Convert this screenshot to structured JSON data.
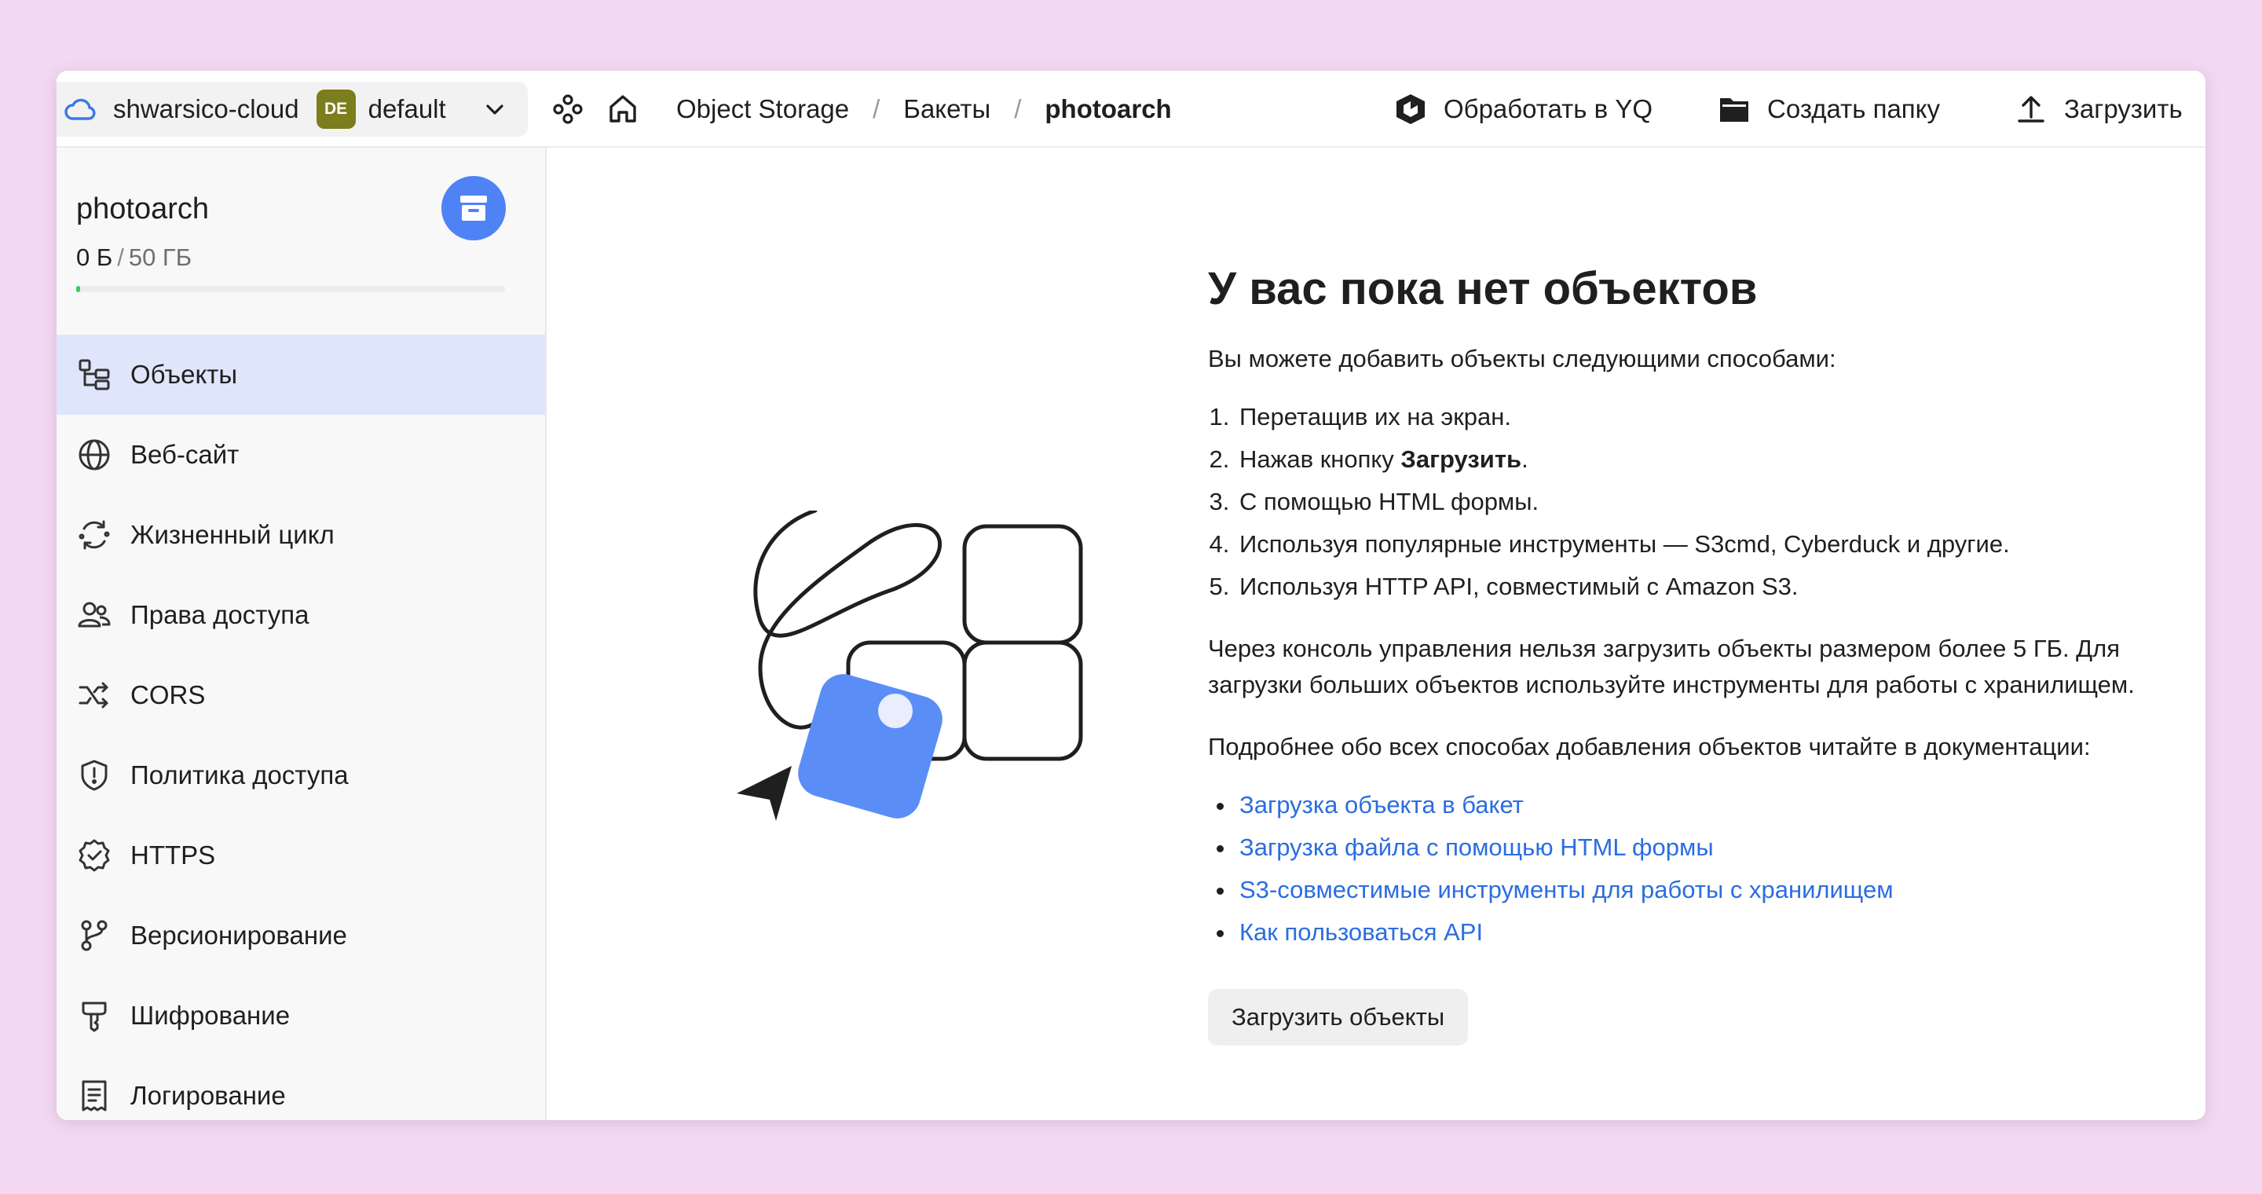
{
  "topbar": {
    "cloud_name": "shwarsico-cloud",
    "folder_badge": "DE",
    "folder_name": "default",
    "breadcrumb": {
      "service": "Object Storage",
      "section": "Бакеты",
      "current": "photoarch"
    },
    "actions": {
      "process_yq": "Обработать в YQ",
      "create_folder": "Создать папку",
      "upload": "Загрузить"
    }
  },
  "sidebar": {
    "bucket_name": "photoarch",
    "usage_used": "0 Б",
    "usage_separator": "/",
    "usage_total": "50 ГБ",
    "usage_fraction": 0.01,
    "items": [
      {
        "label": "Объекты",
        "icon": "objects-icon",
        "active": true
      },
      {
        "label": "Веб-сайт",
        "icon": "globe-icon"
      },
      {
        "label": "Жизненный цикл",
        "icon": "lifecycle-icon"
      },
      {
        "label": "Права доступа",
        "icon": "users-icon"
      },
      {
        "label": "CORS",
        "icon": "shuffle-icon"
      },
      {
        "label": "Политика доступа",
        "icon": "shield-icon"
      },
      {
        "label": "HTTPS",
        "icon": "verified-icon"
      },
      {
        "label": "Версионирование",
        "icon": "branch-icon"
      },
      {
        "label": "Шифрование",
        "icon": "key-icon"
      },
      {
        "label": "Логирование",
        "icon": "log-icon"
      }
    ]
  },
  "main": {
    "title": "У вас пока нет объектов",
    "intro": "Вы можете добавить объекты следующими способами:",
    "steps": [
      "Перетащив их на экран.",
      "Нажав кнопку ",
      "С помощью HTML формы.",
      "Используя популярные инструменты — S3cmd, Cyberduck и другие.",
      "Используя HTTP API, совместимый с Amazon S3."
    ],
    "step2_bold": "Загрузить",
    "step2_end": ".",
    "note": "Через консоль управления нельзя загрузить объекты размером более 5 ГБ. Для загрузки больших объектов используйте инструменты для работы с хранилищем.",
    "more": "Подробнее обо всех способах добавления объектов читайте в документации:",
    "links": [
      "Загрузка объекта в бакет",
      "Загрузка файла с помощью HTML формы",
      "S3-совместимые инструменты для работы с хранилищем",
      "Как пользоваться API"
    ],
    "upload_button": "Загрузить объекты"
  },
  "colors": {
    "background": "#f2d8f2",
    "accent": "#4f83f5",
    "link": "#2b6de0",
    "active_item": "#dfe5fb",
    "folder_badge": "#7c7d1c",
    "usage": "#3cc85a"
  }
}
